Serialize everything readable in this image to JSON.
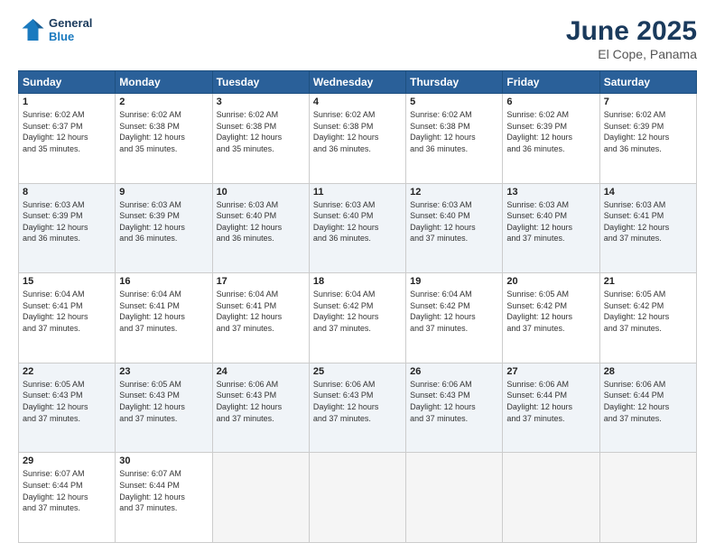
{
  "header": {
    "logo_line1": "General",
    "logo_line2": "Blue",
    "month": "June 2025",
    "location": "El Cope, Panama"
  },
  "days_of_week": [
    "Sunday",
    "Monday",
    "Tuesday",
    "Wednesday",
    "Thursday",
    "Friday",
    "Saturday"
  ],
  "weeks": [
    [
      {
        "day": "1",
        "lines": [
          "Sunrise: 6:02 AM",
          "Sunset: 6:37 PM",
          "Daylight: 12 hours",
          "and 35 minutes."
        ]
      },
      {
        "day": "2",
        "lines": [
          "Sunrise: 6:02 AM",
          "Sunset: 6:38 PM",
          "Daylight: 12 hours",
          "and 35 minutes."
        ]
      },
      {
        "day": "3",
        "lines": [
          "Sunrise: 6:02 AM",
          "Sunset: 6:38 PM",
          "Daylight: 12 hours",
          "and 35 minutes."
        ]
      },
      {
        "day": "4",
        "lines": [
          "Sunrise: 6:02 AM",
          "Sunset: 6:38 PM",
          "Daylight: 12 hours",
          "and 36 minutes."
        ]
      },
      {
        "day": "5",
        "lines": [
          "Sunrise: 6:02 AM",
          "Sunset: 6:38 PM",
          "Daylight: 12 hours",
          "and 36 minutes."
        ]
      },
      {
        "day": "6",
        "lines": [
          "Sunrise: 6:02 AM",
          "Sunset: 6:39 PM",
          "Daylight: 12 hours",
          "and 36 minutes."
        ]
      },
      {
        "day": "7",
        "lines": [
          "Sunrise: 6:02 AM",
          "Sunset: 6:39 PM",
          "Daylight: 12 hours",
          "and 36 minutes."
        ]
      }
    ],
    [
      {
        "day": "8",
        "lines": [
          "Sunrise: 6:03 AM",
          "Sunset: 6:39 PM",
          "Daylight: 12 hours",
          "and 36 minutes."
        ]
      },
      {
        "day": "9",
        "lines": [
          "Sunrise: 6:03 AM",
          "Sunset: 6:39 PM",
          "Daylight: 12 hours",
          "and 36 minutes."
        ]
      },
      {
        "day": "10",
        "lines": [
          "Sunrise: 6:03 AM",
          "Sunset: 6:40 PM",
          "Daylight: 12 hours",
          "and 36 minutes."
        ]
      },
      {
        "day": "11",
        "lines": [
          "Sunrise: 6:03 AM",
          "Sunset: 6:40 PM",
          "Daylight: 12 hours",
          "and 36 minutes."
        ]
      },
      {
        "day": "12",
        "lines": [
          "Sunrise: 6:03 AM",
          "Sunset: 6:40 PM",
          "Daylight: 12 hours",
          "and 37 minutes."
        ]
      },
      {
        "day": "13",
        "lines": [
          "Sunrise: 6:03 AM",
          "Sunset: 6:40 PM",
          "Daylight: 12 hours",
          "and 37 minutes."
        ]
      },
      {
        "day": "14",
        "lines": [
          "Sunrise: 6:03 AM",
          "Sunset: 6:41 PM",
          "Daylight: 12 hours",
          "and 37 minutes."
        ]
      }
    ],
    [
      {
        "day": "15",
        "lines": [
          "Sunrise: 6:04 AM",
          "Sunset: 6:41 PM",
          "Daylight: 12 hours",
          "and 37 minutes."
        ]
      },
      {
        "day": "16",
        "lines": [
          "Sunrise: 6:04 AM",
          "Sunset: 6:41 PM",
          "Daylight: 12 hours",
          "and 37 minutes."
        ]
      },
      {
        "day": "17",
        "lines": [
          "Sunrise: 6:04 AM",
          "Sunset: 6:41 PM",
          "Daylight: 12 hours",
          "and 37 minutes."
        ]
      },
      {
        "day": "18",
        "lines": [
          "Sunrise: 6:04 AM",
          "Sunset: 6:42 PM",
          "Daylight: 12 hours",
          "and 37 minutes."
        ]
      },
      {
        "day": "19",
        "lines": [
          "Sunrise: 6:04 AM",
          "Sunset: 6:42 PM",
          "Daylight: 12 hours",
          "and 37 minutes."
        ]
      },
      {
        "day": "20",
        "lines": [
          "Sunrise: 6:05 AM",
          "Sunset: 6:42 PM",
          "Daylight: 12 hours",
          "and 37 minutes."
        ]
      },
      {
        "day": "21",
        "lines": [
          "Sunrise: 6:05 AM",
          "Sunset: 6:42 PM",
          "Daylight: 12 hours",
          "and 37 minutes."
        ]
      }
    ],
    [
      {
        "day": "22",
        "lines": [
          "Sunrise: 6:05 AM",
          "Sunset: 6:43 PM",
          "Daylight: 12 hours",
          "and 37 minutes."
        ]
      },
      {
        "day": "23",
        "lines": [
          "Sunrise: 6:05 AM",
          "Sunset: 6:43 PM",
          "Daylight: 12 hours",
          "and 37 minutes."
        ]
      },
      {
        "day": "24",
        "lines": [
          "Sunrise: 6:06 AM",
          "Sunset: 6:43 PM",
          "Daylight: 12 hours",
          "and 37 minutes."
        ]
      },
      {
        "day": "25",
        "lines": [
          "Sunrise: 6:06 AM",
          "Sunset: 6:43 PM",
          "Daylight: 12 hours",
          "and 37 minutes."
        ]
      },
      {
        "day": "26",
        "lines": [
          "Sunrise: 6:06 AM",
          "Sunset: 6:43 PM",
          "Daylight: 12 hours",
          "and 37 minutes."
        ]
      },
      {
        "day": "27",
        "lines": [
          "Sunrise: 6:06 AM",
          "Sunset: 6:44 PM",
          "Daylight: 12 hours",
          "and 37 minutes."
        ]
      },
      {
        "day": "28",
        "lines": [
          "Sunrise: 6:06 AM",
          "Sunset: 6:44 PM",
          "Daylight: 12 hours",
          "and 37 minutes."
        ]
      }
    ],
    [
      {
        "day": "29",
        "lines": [
          "Sunrise: 6:07 AM",
          "Sunset: 6:44 PM",
          "Daylight: 12 hours",
          "and 37 minutes."
        ]
      },
      {
        "day": "30",
        "lines": [
          "Sunrise: 6:07 AM",
          "Sunset: 6:44 PM",
          "Daylight: 12 hours",
          "and 37 minutes."
        ]
      },
      null,
      null,
      null,
      null,
      null
    ]
  ]
}
